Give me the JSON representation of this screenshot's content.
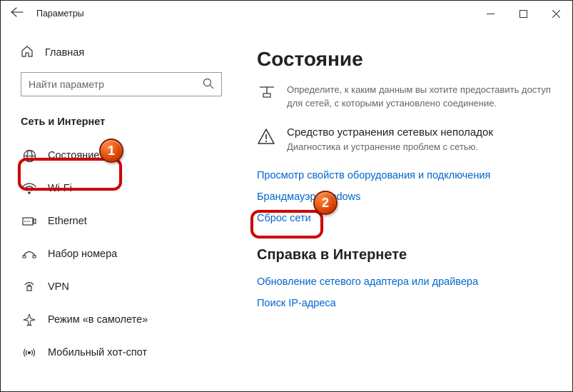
{
  "titlebar": {
    "title": "Параметры"
  },
  "sidebar": {
    "home": "Главная",
    "search_placeholder": "Найти параметр",
    "heading": "Сеть и Интернет",
    "items": [
      {
        "label": "Состояние"
      },
      {
        "label": "Wi-Fi"
      },
      {
        "label": "Ethernet"
      },
      {
        "label": "Набор номера"
      },
      {
        "label": "VPN"
      },
      {
        "label": "Режим «в самолете»"
      },
      {
        "label": "Мобильный хот-спот"
      }
    ]
  },
  "main": {
    "heading": "Состояние",
    "intro_desc": "Определите, к каким данным вы хотите предоставить доступ для сетей, с которыми установлено соединение.",
    "troubleshoot_title": "Средство устранения сетевых неполадок",
    "troubleshoot_desc": "Диагностика и устранение проблем с сетью.",
    "link_props": "Просмотр свойств оборудования и подключения",
    "link_firewall": "Брандмауэр Windows",
    "link_reset": "Сброс сети",
    "help_heading": "Справка в Интернете",
    "link_update": "Обновление сетевого адаптера или драйвера",
    "link_ip": "Поиск IP-адреса"
  },
  "badges": {
    "one": "1",
    "two": "2"
  }
}
